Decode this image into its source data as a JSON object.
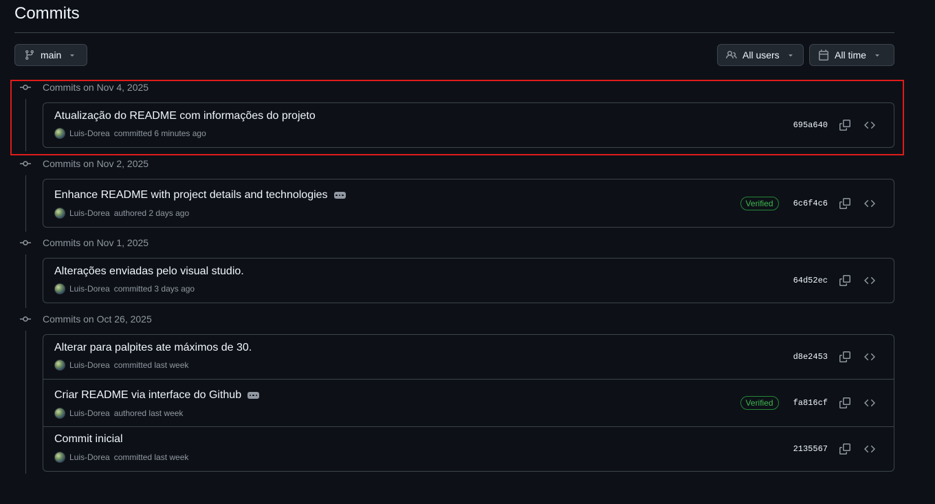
{
  "page": {
    "title": "Commits"
  },
  "toolbar": {
    "branch_label": "main",
    "users_label": "All users",
    "time_label": "All time"
  },
  "groups": [
    {
      "heading": "Commits on Nov 4, 2025",
      "commits": [
        {
          "message": "Atualização do README com informações do projeto",
          "author": "Luis-Dorea",
          "action": "committed 6 minutes ago",
          "sha": "695a640"
        }
      ]
    },
    {
      "heading": "Commits on Nov 2, 2025",
      "commits": [
        {
          "message": "Enhance README with project details and technologies",
          "author": "Luis-Dorea",
          "action": "authored 2 days ago",
          "sha": "6c6f4c6",
          "verified": "Verified"
        }
      ]
    },
    {
      "heading": "Commits on Nov 1, 2025",
      "commits": [
        {
          "message": "Alterações enviadas pelo visual studio.",
          "author": "Luis-Dorea",
          "action": "committed 3 days ago",
          "sha": "64d52ec"
        }
      ]
    },
    {
      "heading": "Commits on Oct 26, 2025",
      "commits": [
        {
          "message": "Alterar para palpites ate máximos de 30.",
          "author": "Luis-Dorea",
          "action": "committed last week",
          "sha": "d8e2453"
        },
        {
          "message": "Criar README via interface do Github",
          "author": "Luis-Dorea",
          "action": "authored last week",
          "sha": "fa816cf",
          "verified": "Verified"
        },
        {
          "message": "Commit inicial",
          "author": "Luis-Dorea",
          "action": "committed last week",
          "sha": "2135567"
        }
      ]
    }
  ],
  "colors": {
    "background": "#0d1117",
    "border": "#3d444d",
    "muted_text": "#9198a1",
    "verified_green": "#3fb950",
    "highlight_red": "#e01b1b"
  }
}
